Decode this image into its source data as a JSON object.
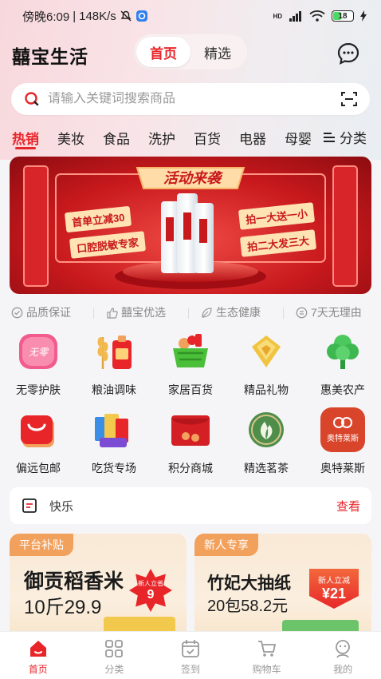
{
  "status_bar": {
    "time": "傍晚6:09",
    "speed": "148K/s",
    "network": "HD",
    "battery": "18"
  },
  "header": {
    "app_title": "囍宝生活",
    "tabs": [
      {
        "label": "首页",
        "active": true
      },
      {
        "label": "精选",
        "active": false
      }
    ]
  },
  "search": {
    "placeholder": "请输入关键词搜索商品"
  },
  "categories": {
    "items": [
      "热销",
      "美妆",
      "食品",
      "洗护",
      "百货",
      "电器",
      "母婴"
    ],
    "active_index": 0,
    "more_label": "分类"
  },
  "banner": {
    "headline": "活动来袭",
    "left_tags": [
      "首单立减30",
      "口腔脱敏专家"
    ],
    "right_tags": [
      "拍一大送一小",
      "拍二大发三大"
    ]
  },
  "features": [
    "品质保证",
    "囍宝优选",
    "生态健康",
    "7天无理由"
  ],
  "grid": {
    "row1": [
      {
        "label": "无零护肤",
        "icon": "skincare-icon"
      },
      {
        "label": "粮油调味",
        "icon": "grain-oil-icon"
      },
      {
        "label": "家居百货",
        "icon": "basket-icon"
      },
      {
        "label": "精品礼物",
        "icon": "gift-icon"
      },
      {
        "label": "惠美农产",
        "icon": "tree-icon"
      }
    ],
    "row2": [
      {
        "label": "偏远包邮",
        "icon": "shopping-bag-icon"
      },
      {
        "label": "吃货专场",
        "icon": "snacks-icon"
      },
      {
        "label": "积分商城",
        "icon": "red-envelope-icon"
      },
      {
        "label": "精选茗茶",
        "icon": "tea-icon"
      },
      {
        "label": "奥特莱斯",
        "icon": "outlet-icon"
      }
    ]
  },
  "outlet_icon_text": "奥特莱斯",
  "notice": {
    "text": "快乐",
    "more": "查看"
  },
  "promos": [
    {
      "tag": "平台补贴",
      "title": "御贡稻香米",
      "price": "10斤29.9",
      "badge_top": "新人立省",
      "badge_value": "9"
    },
    {
      "tag": "新人专享",
      "title": "竹妃大抽纸",
      "price": "20包58.2元",
      "badge_top": "新人立减",
      "badge_value": "¥21"
    }
  ],
  "tabbar": [
    {
      "label": "首页",
      "active": true
    },
    {
      "label": "分类",
      "active": false
    },
    {
      "label": "签到",
      "active": false
    },
    {
      "label": "购物车",
      "active": false
    },
    {
      "label": "我的",
      "active": false
    }
  ],
  "colors": {
    "accent": "#e8262a",
    "promo_tag": "#f2a15d"
  }
}
